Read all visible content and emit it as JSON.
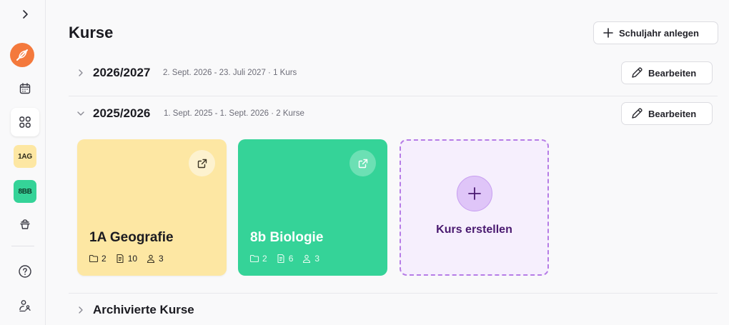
{
  "page": {
    "title": "Kurse"
  },
  "toolbar": {
    "add_year_label": "Schuljahr anlegen"
  },
  "sidebar": {
    "courses": [
      {
        "abbr": "1AG",
        "color": "#fde7a3"
      },
      {
        "abbr": "8BB",
        "color": "#35d398"
      }
    ]
  },
  "school_years": [
    {
      "name": "2026/2027",
      "meta": "2. Sept. 2026 - 23. Juli 2027 · 1 Kurs",
      "expanded": false,
      "edit_label": "Bearbeiten"
    },
    {
      "name": "2025/2026",
      "meta": "1. Sept. 2025 - 1. Sept. 2026 · 2 Kurse",
      "expanded": true,
      "edit_label": "Bearbeiten"
    }
  ],
  "courses": [
    {
      "title": "1A Geografie",
      "folders": "2",
      "documents": "10",
      "students": "3",
      "bg": "#fde7a3",
      "text_color": "#1b1b21"
    },
    {
      "title": "8b Biologie",
      "folders": "2",
      "documents": "6",
      "students": "3",
      "bg": "#35d398",
      "text_color": "#ffffff"
    }
  ],
  "create_course": {
    "label": "Kurs erstellen"
  },
  "archived": {
    "label": "Archivierte Kurse"
  }
}
